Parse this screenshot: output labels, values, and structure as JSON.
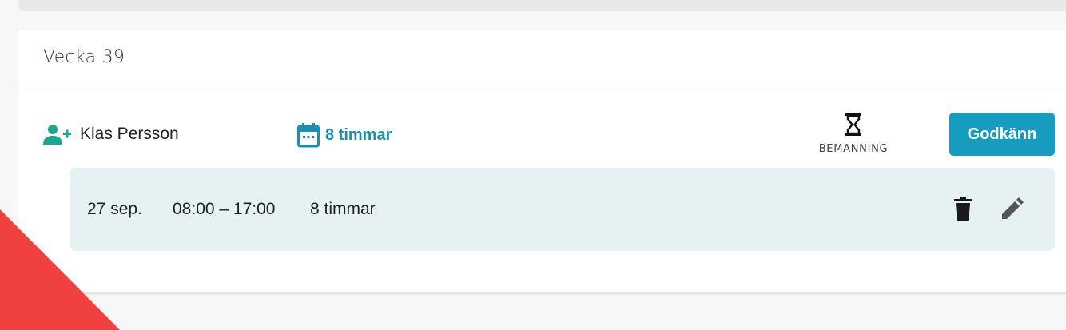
{
  "week": {
    "title": "Vecka 39"
  },
  "person": {
    "icon": "person-add-icon",
    "name": "Klas Persson"
  },
  "summary": {
    "icon": "calendar-icon",
    "hours_label": "8 timmar"
  },
  "bemanning": {
    "icon": "hourglass-icon",
    "label": "BEMANNING"
  },
  "actions": {
    "approve_label": "Godkänn"
  },
  "shift": {
    "date": "27 sep.",
    "time_range": "08:00 – 17:00",
    "hours": "8 timmar",
    "delete_icon": "trash-icon",
    "edit_icon": "pencil-icon"
  },
  "colors": {
    "accent": "#179cbf",
    "person_icon": "#1aa88c",
    "shift_background": "#e5f1f3",
    "ribbon": "#f04040"
  }
}
